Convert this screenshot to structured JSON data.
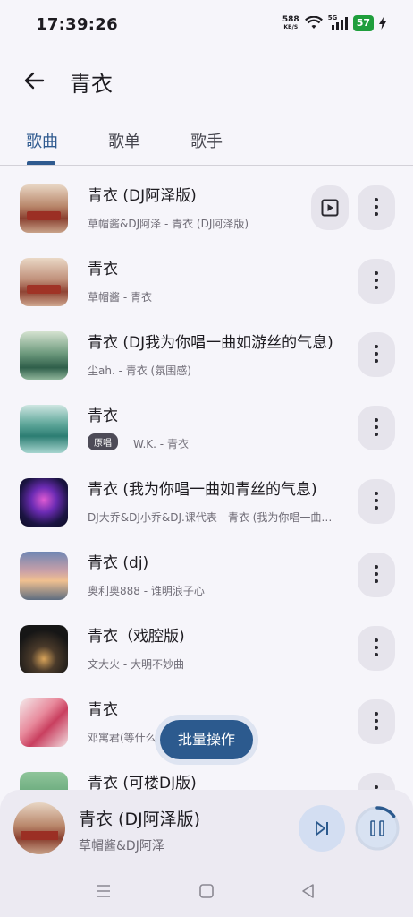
{
  "status_bar": {
    "time": "17:39:26",
    "net_speed_value": "588",
    "net_speed_unit": "KB/S",
    "signal_label": "5G",
    "battery": "57"
  },
  "header": {
    "title": "青衣"
  },
  "tabs": [
    {
      "label": "歌曲",
      "active": true
    },
    {
      "label": "歌单",
      "active": false
    },
    {
      "label": "歌手",
      "active": false
    }
  ],
  "songs": [
    {
      "title": "青衣 (DJ阿泽版)",
      "subtitle": "草帽酱&DJ阿泽 - 青衣 (DJ阿泽版)",
      "badge": "",
      "has_play": true
    },
    {
      "title": "青衣",
      "subtitle": "草帽酱 - 青衣",
      "badge": ""
    },
    {
      "title": "青衣 (DJ我为你唱一曲如游丝的气息)",
      "subtitle": "尘ah. - 青衣 (氛围感)",
      "badge": ""
    },
    {
      "title": "青衣",
      "subtitle": "W.K. - 青衣",
      "badge": "原唱"
    },
    {
      "title": "青衣 (我为你唱一曲如青丝的气息)",
      "subtitle": "DJ大乔&DJ小乔&DJ.课代表 - 青衣 (我为你唱一曲如青丝的气息)",
      "badge": ""
    },
    {
      "title": "青衣 (dj)",
      "subtitle": "奥利奥888 - 谁明浪子心",
      "badge": ""
    },
    {
      "title": "青衣（戏腔版)",
      "subtitle": "文大火 - 大明不妙曲",
      "badge": ""
    },
    {
      "title": "青衣",
      "subtitle": "邓寓君(等什么",
      "badge": ""
    },
    {
      "title": "青衣 (可楼DJ版)",
      "subtitle": "",
      "badge": ""
    }
  ],
  "batch_button": "批量操作",
  "player": {
    "title": "青衣 (DJ阿泽版)",
    "artist": "草帽酱&DJ阿泽",
    "progress": 0.15
  },
  "icons": {
    "back": "arrow-left-icon",
    "more": "more-vertical-icon",
    "play": "play-box-icon",
    "next": "skip-next-icon",
    "pause": "pause-icon",
    "nav_menu": "menu-icon",
    "nav_home": "home-square-icon",
    "nav_back": "back-triangle-icon"
  },
  "colors": {
    "accent": "#2f5a8f",
    "background": "#f6f5fa",
    "player_bg": "#eceaf2",
    "battery": "#1f9e3c"
  }
}
